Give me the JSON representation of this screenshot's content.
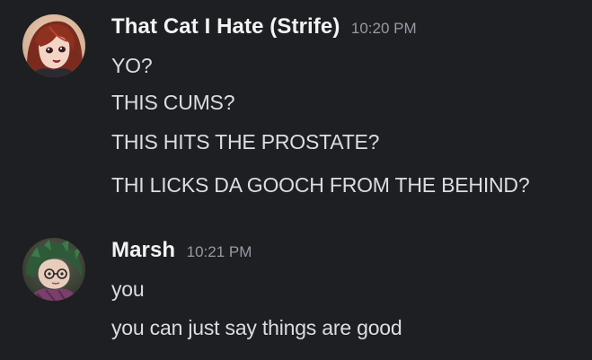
{
  "messages": [
    {
      "username": "That Cat I Hate (Strife)",
      "timestamp": "10:20 PM",
      "avatar_icon": "avatar-red-haired-character",
      "lines": [
        "YO?",
        "THIS CUMS?",
        "THIS HITS THE PROSTATE?",
        "THI LICKS DA GOOCH FROM THE BEHIND?"
      ]
    },
    {
      "username": "Marsh",
      "timestamp": "10:21 PM",
      "avatar_icon": "avatar-green-haired-character",
      "lines": [
        "you",
        "you can just say things are good"
      ]
    }
  ],
  "colors": {
    "background": "#1e1f22",
    "username": "#f2f3f5",
    "timestamp": "#949ba4",
    "message_text": "#dbdee1"
  }
}
